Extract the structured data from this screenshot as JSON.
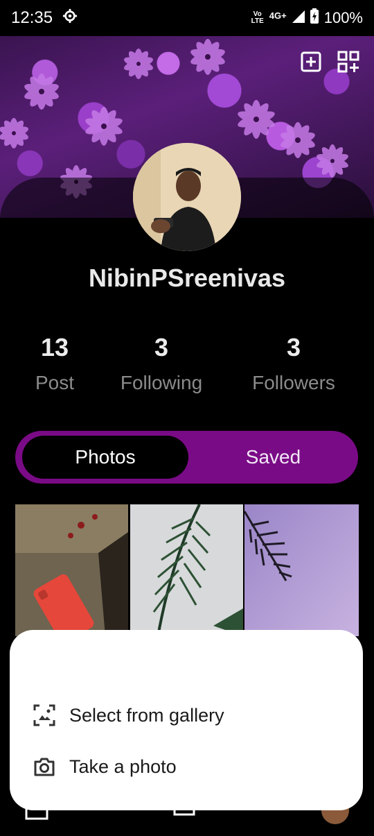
{
  "status_bar": {
    "time": "12:35",
    "volte_label_top": "Vo",
    "volte_label_bottom": "LTE",
    "network": "4G+",
    "battery": "100%"
  },
  "profile": {
    "username": "NibinPSreenivas"
  },
  "stats": [
    {
      "value": "13",
      "label": "Post"
    },
    {
      "value": "3",
      "label": "Following"
    },
    {
      "value": "3",
      "label": "Followers"
    }
  ],
  "tabs": {
    "photos": "Photos",
    "saved": "Saved"
  },
  "sheet": {
    "gallery_label": "Select from gallery",
    "camera_label": "Take a photo"
  },
  "colors": {
    "accent": "#7a0b86",
    "background": "#000000",
    "sheet": "#ffffff"
  },
  "icons": {
    "settings": "gear-icon",
    "add_post": "plus-square-icon",
    "qr": "qr-grid-icon",
    "gallery": "gallery-icon",
    "camera": "camera-icon"
  }
}
